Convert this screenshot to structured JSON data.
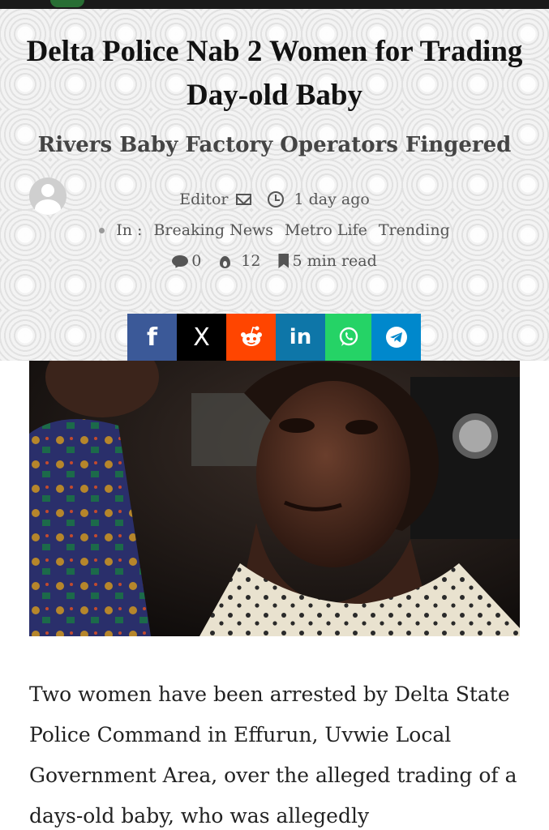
{
  "article": {
    "title": "Delta Police Nab 2 Women for Trading Day-old Baby",
    "subtitle": "Rivers Baby Factory Operators Fingered",
    "author": "Editor",
    "posted": "1 day ago",
    "categories_prefix": "In :",
    "categories": [
      "Breaking News",
      "Metro Life",
      "Trending"
    ],
    "comments": "0",
    "views": "12",
    "read_time": "5 min read",
    "body": "Two women have been arrested by Delta State Police Command in Effurun, Uvwie Local Government Area, over the alleged trading of a days-old baby, who was allegedly"
  },
  "share": {
    "facebook": "f",
    "x": "X",
    "linkedin": "in"
  },
  "icons": {
    "author": "avatar-icon",
    "mail": "mail-icon",
    "time": "clock-icon",
    "comments": "comment-icon",
    "views": "fire-icon",
    "read": "bookmark-icon",
    "reddit": "reddit-icon",
    "whatsapp": "whatsapp-icon",
    "telegram": "telegram-icon"
  },
  "colors": {
    "facebook": "#3b5998",
    "x": "#000000",
    "reddit": "#ff4500",
    "linkedin": "#0e76a8",
    "whatsapp": "#25d366",
    "telegram": "#0088cc"
  }
}
